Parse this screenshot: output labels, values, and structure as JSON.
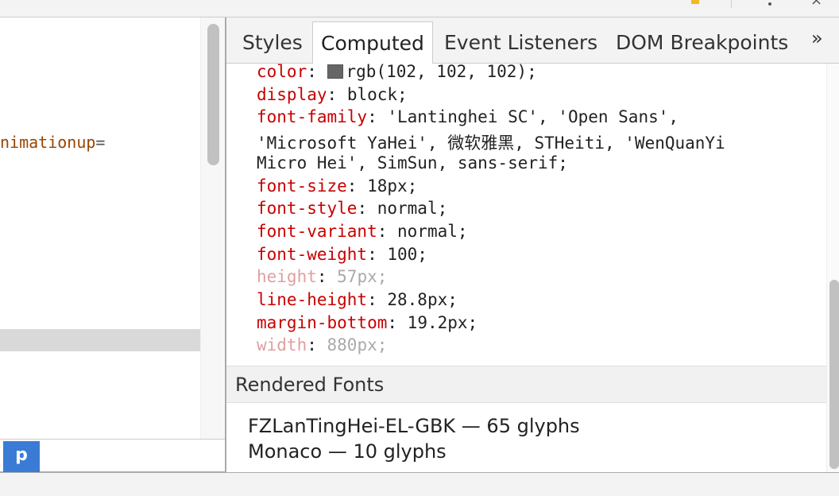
{
  "left": {
    "code_attr": "nimationup",
    "code_eq": "=",
    "breadcrumb": "p"
  },
  "tabs": [
    {
      "label": "Styles"
    },
    {
      "label": "Computed"
    },
    {
      "label": "Event Listeners"
    },
    {
      "label": "DOM Breakpoints"
    }
  ],
  "more": "»",
  "props": [
    {
      "name": "color",
      "value": "rgb(102, 102, 102);",
      "swatch": "#666666"
    },
    {
      "name": "display",
      "value": "block;"
    },
    {
      "name": "font-family",
      "value": "'Lantinghei SC', 'Open Sans',"
    },
    {
      "name": "",
      "value": "'Microsoft YaHei', 微软雅黑, STHeiti, 'WenQuanYi"
    },
    {
      "name": "",
      "value": "Micro Hei', SimSun, sans-serif;"
    },
    {
      "name": "font-size",
      "value": "18px;"
    },
    {
      "name": "font-style",
      "value": "normal;"
    },
    {
      "name": "font-variant",
      "value": "normal;"
    },
    {
      "name": "font-weight",
      "value": "100;"
    },
    {
      "name": "height",
      "value": "57px;"
    },
    {
      "name": "line-height",
      "value": "28.8px;"
    },
    {
      "name": "margin-bottom",
      "value": "19.2px;"
    },
    {
      "name": "width",
      "value": "880px;"
    }
  ],
  "rendered_fonts": {
    "title": "Rendered Fonts",
    "items": [
      "FZLanTingHei-EL-GBK — 65 glyphs",
      "Monaco — 10 glyphs"
    ]
  }
}
